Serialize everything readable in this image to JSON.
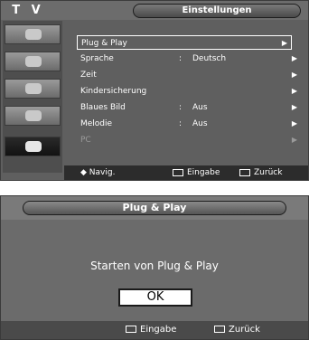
{
  "menu": {
    "tv_label": "T V",
    "title": "Einstellungen",
    "items": [
      {
        "label": "Plug & Play",
        "value": "",
        "arrow": "▶"
      },
      {
        "label": "Sprache",
        "value": "Deutsch",
        "arrow": "▶"
      },
      {
        "label": "Zeit",
        "value": "",
        "arrow": "▶"
      },
      {
        "label": "Kindersicherung",
        "value": "",
        "arrow": "▶"
      },
      {
        "label": "Blaues Bild",
        "value": "Aus",
        "arrow": "▶"
      },
      {
        "label": "Melodie",
        "value": "Aus",
        "arrow": "▶"
      },
      {
        "label": "PC",
        "value": "",
        "arrow": "▶"
      }
    ],
    "colon": ":",
    "footer": {
      "nav": "◆ Navig.",
      "enter": "Eingabe",
      "return": "Zurück"
    }
  },
  "dialog": {
    "title": "Plug & Play",
    "message": "Starten von Plug & Play",
    "ok_label": "OK",
    "footer": {
      "enter": "Eingabe",
      "return": "Zurück"
    }
  },
  "icons": [
    "antenna-icon",
    "picture-icon",
    "sound-icon",
    "channel-icon",
    "setup-icon"
  ]
}
